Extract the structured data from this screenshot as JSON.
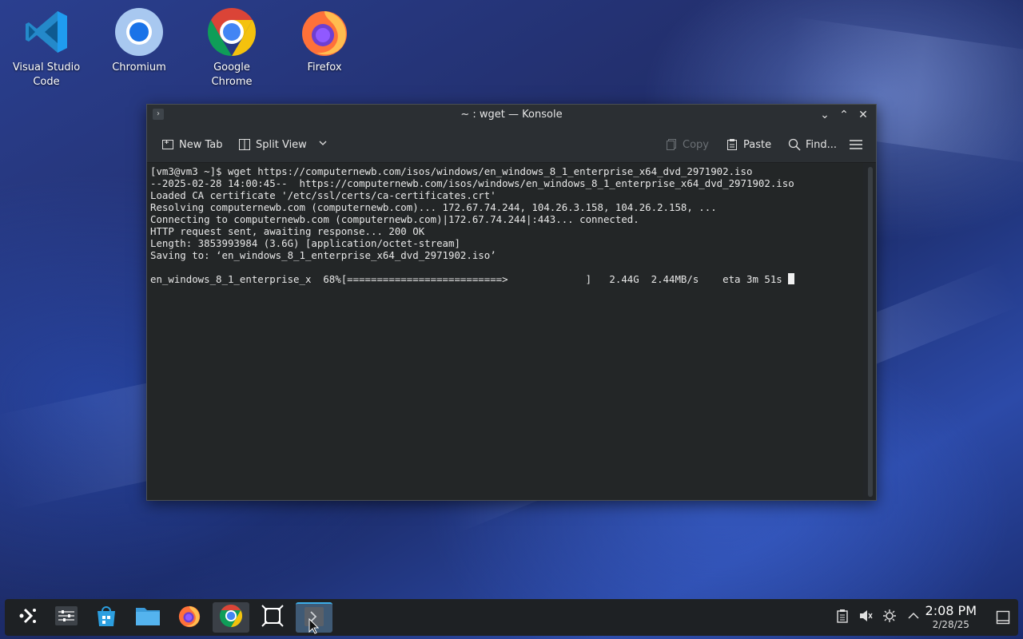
{
  "desktop": {
    "icons": [
      {
        "label": "Visual Studio Code",
        "icon": "vscode-icon"
      },
      {
        "label": "Chromium",
        "icon": "chromium-icon"
      },
      {
        "label": "Google Chrome",
        "icon": "chrome-icon"
      },
      {
        "label": "Firefox",
        "icon": "firefox-icon"
      }
    ]
  },
  "window": {
    "title": "~ : wget — Konsole",
    "toolbar": {
      "new_tab": "New Tab",
      "split_view": "Split View",
      "copy": "Copy",
      "paste": "Paste",
      "find": "Find..."
    },
    "terminal": {
      "lines": [
        "[vm3@vm3 ~]$ wget https://computernewb.com/isos/windows/en_windows_8_1_enterprise_x64_dvd_2971902.iso",
        "--2025-02-28 14:00:45--  https://computernewb.com/isos/windows/en_windows_8_1_enterprise_x64_dvd_2971902.iso",
        "Loaded CA certificate '/etc/ssl/certs/ca-certificates.crt'",
        "Resolving computernewb.com (computernewb.com)... 172.67.74.244, 104.26.3.158, 104.26.2.158, ...",
        "Connecting to computernewb.com (computernewb.com)|172.67.74.244|:443... connected.",
        "HTTP request sent, awaiting response... 200 OK",
        "Length: 3853993984 (3.6G) [application/octet-stream]",
        "Saving to: ‘en_windows_8_1_enterprise_x64_dvd_2971902.iso’",
        ""
      ],
      "progress_line": "en_windows_8_1_enterprise_x  68%[==========================>             ]   2.44G  2.44MB/s    eta 3m 51s "
    }
  },
  "taskbar": {
    "items": [
      "app-launcher-icon",
      "settings-icon",
      "discover-store-icon",
      "file-manager-icon",
      "firefox-icon",
      "chrome-icon",
      "screenshot-icon",
      "konsole-icon"
    ],
    "clock": {
      "time": "2:08 PM",
      "date": "2/28/25"
    }
  },
  "colors": {
    "accent": "#3daee9",
    "terminal_bg": "#232627",
    "taskbar_bg": "#1e2124"
  }
}
